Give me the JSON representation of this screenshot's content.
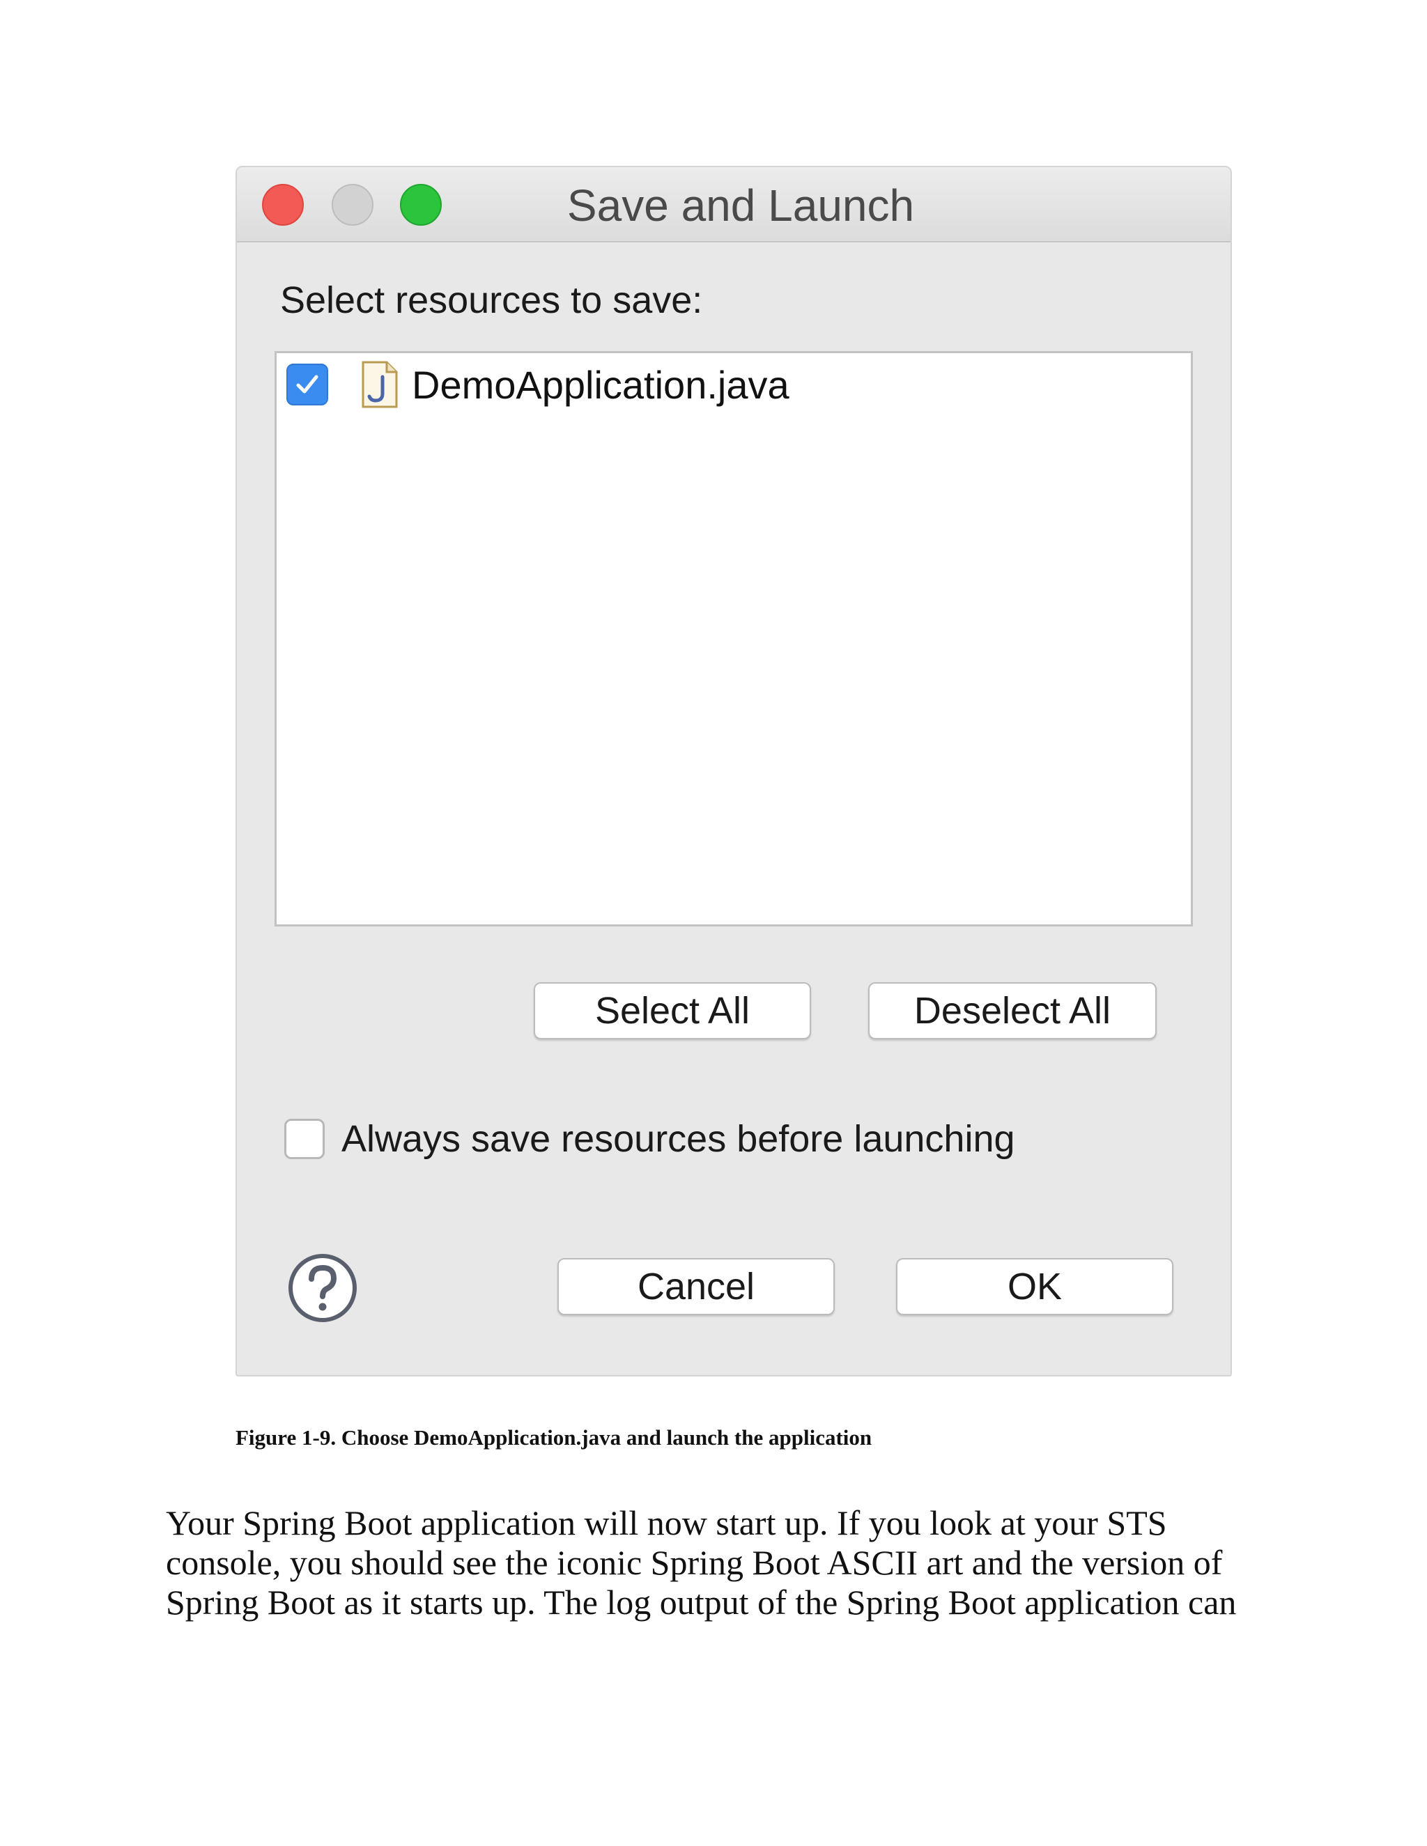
{
  "dialog": {
    "title": "Save and Launch",
    "section_label": "Select resources to save:",
    "resources": [
      {
        "name": "DemoApplication.java",
        "checked": true
      }
    ],
    "select_all_label": "Select All",
    "deselect_all_label": "Deselect All",
    "always_save_label": "Always save resources before launching",
    "always_save_checked": false,
    "cancel_label": "Cancel",
    "ok_label": "OK",
    "icons": {
      "close": "close-traffic-light",
      "minimize": "minimize-traffic-light",
      "maximize": "maximize-traffic-light",
      "file": "java-file-icon",
      "help": "help-icon"
    },
    "colors": {
      "close": "#f25b55",
      "minimize": "#d2d2d2",
      "maximize": "#2cc43d",
      "checkbox_checked": "#3b8cf0"
    }
  },
  "caption": "Figure 1-9. Choose DemoApplication.java and launch the application",
  "body_lines": [
    "Your Spring Boot application will now start up. If you look at your STS",
    "console, you should see the iconic Spring Boot ASCII art and the version of",
    "Spring Boot as it starts up. The log output of the Spring Boot application can"
  ]
}
